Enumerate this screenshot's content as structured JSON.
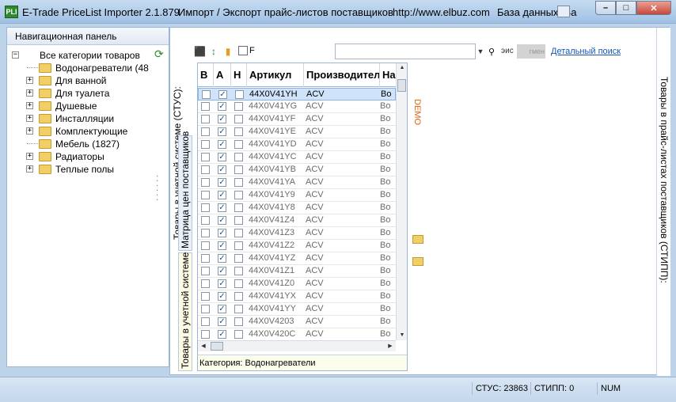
{
  "window": {
    "icon_text": "PLI",
    "title_app": "E-Trade PriceList Importer 2.1.879",
    "title_desc": "Импорт / Экспорт прайс-листов поставщиков",
    "title_url": "http://www.elbuz.com",
    "title_db": "База данных: Ба",
    "minimize": "–",
    "maximize": "□",
    "close": "✕"
  },
  "nav": {
    "header": "Навигационная панель",
    "root": "Все категории товаров",
    "items": [
      {
        "label": "Водонагреватели (48",
        "expandable": false
      },
      {
        "label": "Для ванной",
        "expandable": true
      },
      {
        "label": "Для туалета",
        "expandable": true
      },
      {
        "label": "Душевые",
        "expandable": true
      },
      {
        "label": "Инсталляции",
        "expandable": true
      },
      {
        "label": "Комплектующие",
        "expandable": true
      },
      {
        "label": "Мебель (1827)",
        "expandable": false
      },
      {
        "label": "Радиаторы",
        "expandable": true
      },
      {
        "label": "Теплые полы",
        "expandable": true
      }
    ],
    "expand_glyph": "+",
    "refresh_glyph": "⟳"
  },
  "tabs": {
    "left_outer": "Товары в учетной системе (СТУС):",
    "matrix": "Матрица цен поставщиков",
    "goods": "Товары в учетной системе",
    "right": "Товары в прайс-листах поставщиков (СТИПП):"
  },
  "toolbar": {
    "f_label": "F",
    "search_value": "",
    "dropdown_glyph": "▼",
    "eis_label": "эис",
    "gray_label": "гмен",
    "detail_link": "Детальный поиск"
  },
  "grid": {
    "headers": [
      "В",
      "А",
      "Н",
      "Артикул",
      "Производитель",
      "На"
    ],
    "rows": [
      {
        "article": "44X0V41YH",
        "mfr": "ACV",
        "name": "Во",
        "a": true
      },
      {
        "article": "44X0V41YG",
        "mfr": "ACV",
        "name": "Во",
        "a": true
      },
      {
        "article": "44X0V41YF",
        "mfr": "ACV",
        "name": "Во",
        "a": true
      },
      {
        "article": "44X0V41YE",
        "mfr": "ACV",
        "name": "Во",
        "a": true
      },
      {
        "article": "44X0V41YD",
        "mfr": "ACV",
        "name": "Во",
        "a": true
      },
      {
        "article": "44X0V41YC",
        "mfr": "ACV",
        "name": "Во",
        "a": true
      },
      {
        "article": "44X0V41YB",
        "mfr": "ACV",
        "name": "Во",
        "a": true
      },
      {
        "article": "44X0V41YA",
        "mfr": "ACV",
        "name": "Во",
        "a": true
      },
      {
        "article": "44X0V41Y9",
        "mfr": "ACV",
        "name": "Во",
        "a": true
      },
      {
        "article": "44X0V41Y8",
        "mfr": "ACV",
        "name": "Во",
        "a": true
      },
      {
        "article": "44X0V41Z4",
        "mfr": "ACV",
        "name": "Во",
        "a": true
      },
      {
        "article": "44X0V41Z3",
        "mfr": "ACV",
        "name": "Во",
        "a": true
      },
      {
        "article": "44X0V41Z2",
        "mfr": "ACV",
        "name": "Во",
        "a": true
      },
      {
        "article": "44X0V41YZ",
        "mfr": "ACV",
        "name": "Во",
        "a": true
      },
      {
        "article": "44X0V41Z1",
        "mfr": "ACV",
        "name": "Во",
        "a": true
      },
      {
        "article": "44X0V41Z0",
        "mfr": "ACV",
        "name": "Во",
        "a": true
      },
      {
        "article": "44X0V41YX",
        "mfr": "ACV",
        "name": "Во",
        "a": true
      },
      {
        "article": "44X0V41YY",
        "mfr": "ACV",
        "name": "Во",
        "a": true
      },
      {
        "article": "44X0V4203",
        "mfr": "ACV",
        "name": "Во",
        "a": true
      },
      {
        "article": "44X0V420C",
        "mfr": "ACV",
        "name": "Во",
        "a": true
      }
    ],
    "check_glyph": "✓",
    "scroll_up": "▲",
    "scroll_down": "▼",
    "scroll_left": "◀",
    "scroll_right": "▶",
    "footer": "Категория: Водонагреватели"
  },
  "demo_label": "DEMO",
  "status": {
    "stus": "СТУС: 23863",
    "stipp": "СТИПП: 0",
    "num": "NUM"
  }
}
